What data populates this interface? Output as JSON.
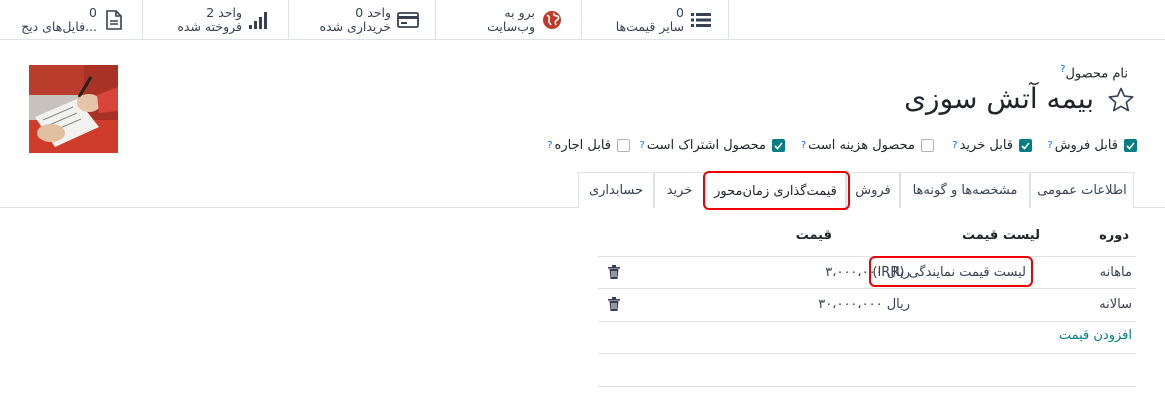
{
  "smart_buttons": [
    {
      "value": "0",
      "label": "فایل‌های دیج...",
      "icon": "file-icon"
    },
    {
      "value": "2 واحد",
      "label": "فروخته شده",
      "icon": "bar-chart-icon"
    },
    {
      "value": "0 واحد",
      "label": "خریداری شده",
      "icon": "credit-card-icon"
    },
    {
      "value": "برو به",
      "label": "وب‌سایت",
      "icon": "globe-icon"
    },
    {
      "value": "0",
      "label": "سایر قیمت‌ها",
      "icon": "list-icon"
    }
  ],
  "product": {
    "name_label": "نام محصول",
    "name_help": "?",
    "title": "بیمه آتش سوزی"
  },
  "checkboxes": [
    {
      "label": "قابل فروش",
      "checked": true
    },
    {
      "label": "قابل خرید",
      "checked": true
    },
    {
      "label": "محصول هزینه است",
      "checked": false
    },
    {
      "label": "محصول اشتراک است",
      "checked": true
    },
    {
      "label": "قابل اجاره",
      "checked": false
    }
  ],
  "help_mark": "?",
  "tabs": [
    {
      "label": "اطلاعات عمومی"
    },
    {
      "label": "مشخصه‌ها و گونه‌ها"
    },
    {
      "label": "فروش"
    },
    {
      "label": "قیمت‌گذاری زمان‌محور",
      "active": true
    },
    {
      "label": "خرید"
    },
    {
      "label": "حسابداری"
    }
  ],
  "table": {
    "headers": {
      "period": "دوره",
      "pricelist": "لیست قیمت",
      "price": "قیمت"
    },
    "rows": [
      {
        "period": "ماهانه",
        "pricelist": "لیست قیمت نمایندگی (IRR)",
        "price": "ریال ۳،۰۰۰،۰۰۰"
      },
      {
        "period": "سالانه",
        "pricelist": "",
        "price": "ریال ۳۰،۰۰۰،۰۰۰"
      }
    ],
    "add_line": "افزودن قیمت"
  },
  "colors": {
    "accent": "#017e84",
    "highlight": "#e00000",
    "globe": "#c0392b"
  }
}
